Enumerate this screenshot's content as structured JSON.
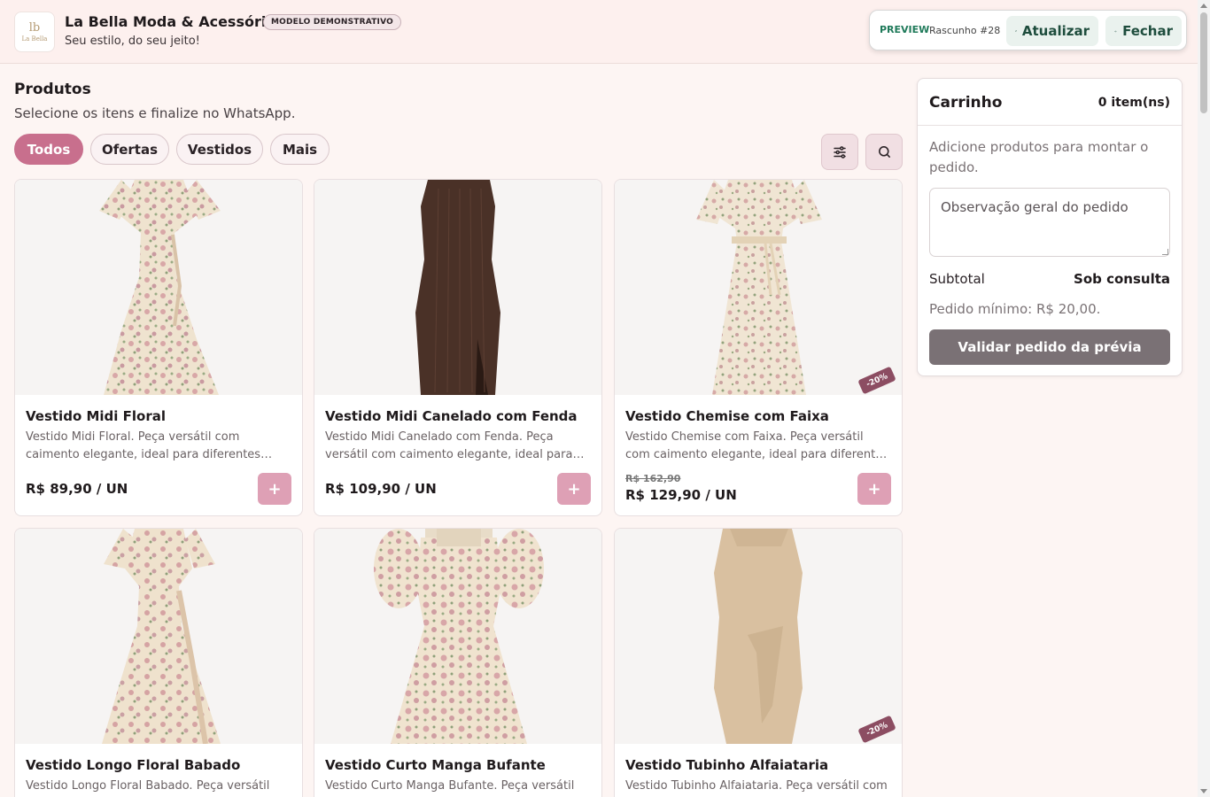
{
  "header": {
    "logo_monogram": "lb",
    "logo_name": "La Bella",
    "store_name": "La Bella Moda & Acessórios",
    "demo_badge": "MODELO DEMONSTRATIVO",
    "tagline": "Seu estilo, do seu jeito!"
  },
  "preview_bar": {
    "label": "PREVIEW",
    "draft": "Rascunho #28",
    "refresh_label": "Atualizar",
    "close_label": "Fechar"
  },
  "products": {
    "title": "Produtos",
    "subtitle": "Selecione os itens e finalize no WhatsApp.",
    "filters": [
      "Todos",
      "Ofertas",
      "Vestidos",
      "Mais"
    ],
    "active_filter": "Todos",
    "items": [
      {
        "name": "Vestido Midi Floral",
        "description": "Vestido Midi Floral. Peça versátil com caimento elegante, ideal para diferentes ocasiões.",
        "price": "R$ 89,90 / UN",
        "old_price": "",
        "discount": "",
        "add_label": "+"
      },
      {
        "name": "Vestido Midi Canelado com Fenda",
        "description": "Vestido Midi Canelado com Fenda. Peça versátil com caimento elegante, ideal para diferentes ocasiões.",
        "price": "R$ 109,90 / UN",
        "old_price": "",
        "discount": "",
        "add_label": "+"
      },
      {
        "name": "Vestido Chemise com Faixa",
        "description": "Vestido Chemise com Faixa. Peça versátil com caimento elegante, ideal para diferentes ocasiões.",
        "price": "R$ 129,90 / UN",
        "old_price": "R$ 162,90",
        "discount": "-20%",
        "add_label": "+"
      },
      {
        "name": "Vestido Longo Floral Babado",
        "description": "Vestido Longo Floral Babado. Peça versátil com caimento elegante, ideal para diferentes ocasiões.",
        "price": "",
        "old_price": "",
        "discount": "",
        "add_label": "+"
      },
      {
        "name": "Vestido Curto Manga Bufante",
        "description": "Vestido Curto Manga Bufante. Peça versátil com caimento elegante, ideal para diferentes ocasiões.",
        "price": "",
        "old_price": "",
        "discount": "",
        "add_label": "+"
      },
      {
        "name": "Vestido Tubinho Alfaiataria",
        "description": "Vestido Tubinho Alfaiataria. Peça versátil com caimento elegante, ideal para diferentes ocasiões.",
        "price": "",
        "old_price": "",
        "discount": "-20%",
        "add_label": "+"
      }
    ]
  },
  "cart": {
    "title": "Carrinho",
    "count": "0 item(ns)",
    "empty_message": "Adicione produtos para montar o pedido.",
    "note_placeholder": "Observação geral do pedido",
    "subtotal_label": "Subtotal",
    "subtotal_value": "Sob consulta",
    "min_order": "Pedido mínimo: R$ 20,00.",
    "validate_label": "Validar pedido da prévia"
  },
  "colors": {
    "accent": "#c86f8d",
    "add_button": "#dea0b5",
    "discount_badge": "#8c4d62",
    "preview_green": "#1f7a5a",
    "validate_button": "#7a7175"
  }
}
